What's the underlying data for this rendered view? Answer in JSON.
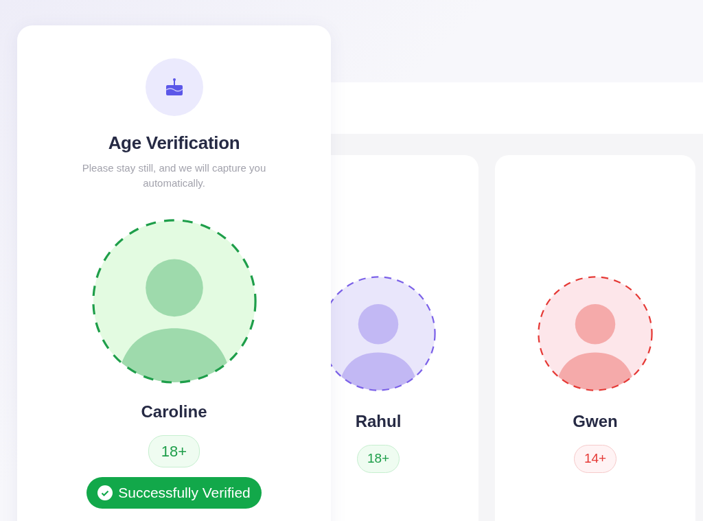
{
  "verification_card": {
    "title": "Age Verification",
    "subtitle": "Please stay still, and we will capture you automatically.",
    "person": {
      "name": "Caroline",
      "age": "18+",
      "passed": true,
      "color": "#1e9e4a"
    },
    "result": {
      "label": "Successfully Verified",
      "verified": true
    }
  },
  "people": [
    {
      "name": "Rahul",
      "age": "18+",
      "passed": true,
      "color": "#7b61e8"
    },
    {
      "name": "Gwen",
      "age": "14+",
      "passed": false,
      "color": "#e53935"
    }
  ]
}
